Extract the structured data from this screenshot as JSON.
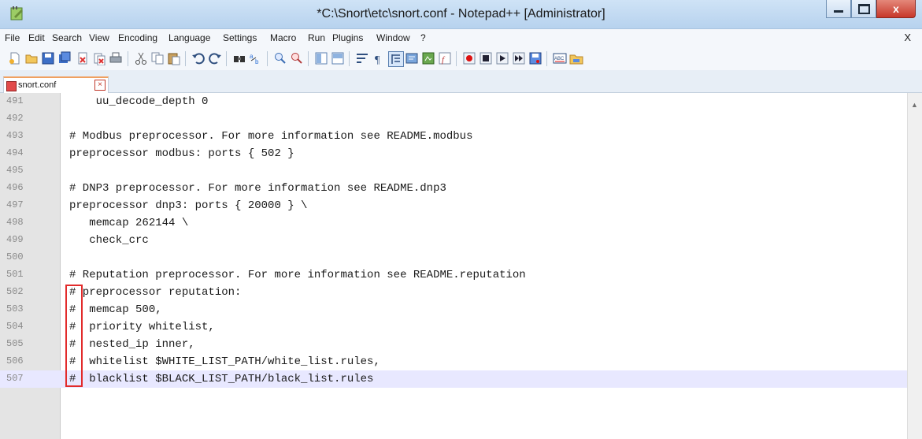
{
  "window": {
    "title": "*C:\\Snort\\etc\\snort.conf - Notepad++ [Administrator]",
    "icons": {
      "app": "notepad-plus-plus-icon",
      "minimize": "minimize-icon",
      "maximize": "maximize-icon",
      "close": "close-icon"
    }
  },
  "menu": {
    "items": [
      "File",
      "Edit",
      "Search",
      "View",
      "Encoding",
      "Language",
      "Settings",
      "Macro",
      "Run",
      "Plugins",
      "Window",
      "?"
    ],
    "close_doc": "X"
  },
  "toolbar": {
    "buttons": [
      "new-file-icon",
      "open-file-icon",
      "save-icon",
      "save-all-icon",
      "close-icon",
      "close-all-icon",
      "print-icon",
      "cut-icon",
      "copy-icon",
      "paste-icon",
      "undo-icon",
      "redo-icon",
      "find-icon",
      "replace-icon",
      "zoom-in-icon",
      "zoom-out-icon",
      "sync-vertical-icon",
      "sync-horizontal-icon",
      "word-wrap-icon",
      "show-all-chars-icon",
      "indent-guide-icon",
      "user-language-icon",
      "doc-map-icon",
      "function-list-icon",
      "record-macro-icon",
      "stop-macro-icon",
      "play-macro-icon",
      "run-macro-multiple-icon",
      "save-macro-icon",
      "spell-check-icon",
      "folder-icon"
    ]
  },
  "tab": {
    "label": "snort.conf",
    "icon": "save-disk-red-icon",
    "close_icon": "tab-close-icon",
    "close_glyph": "×"
  },
  "editor": {
    "current_line": "507",
    "lines": [
      {
        "num": "491",
        "text": "    uu_decode_depth 0"
      },
      {
        "num": "492",
        "text": ""
      },
      {
        "num": "493",
        "text": "# Modbus preprocessor. For more information see README.modbus"
      },
      {
        "num": "494",
        "text": "preprocessor modbus: ports { 502 }"
      },
      {
        "num": "495",
        "text": ""
      },
      {
        "num": "496",
        "text": "# DNP3 preprocessor. For more information see README.dnp3"
      },
      {
        "num": "497",
        "text": "preprocessor dnp3: ports { 20000 } \\"
      },
      {
        "num": "498",
        "text": "   memcap 262144 \\"
      },
      {
        "num": "499",
        "text": "   check_crc"
      },
      {
        "num": "500",
        "text": ""
      },
      {
        "num": "501",
        "text": "# Reputation preprocessor. For more information see README.reputation"
      },
      {
        "num": "502",
        "text": "# preprocessor reputation:"
      },
      {
        "num": "503",
        "text": "#  memcap 500,"
      },
      {
        "num": "504",
        "text": "#  priority whitelist,"
      },
      {
        "num": "505",
        "text": "#  nested_ip inner,"
      },
      {
        "num": "506",
        "text": "#  whitelist $WHITE_LIST_PATH/white_list.rules,"
      },
      {
        "num": "507",
        "text": "#  blacklist $BLACK_LIST_PATH/black_list.rules"
      }
    ]
  },
  "colors": {
    "highlight_box": "#e22b2b",
    "current_line_bg": "#e8e8ff",
    "title_bar": "#c4dcf3"
  }
}
